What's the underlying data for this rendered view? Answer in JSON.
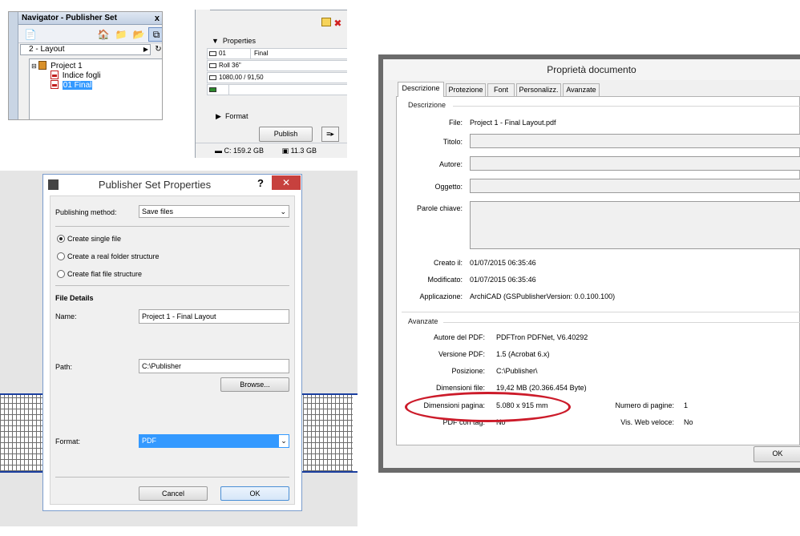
{
  "navigator": {
    "title": "Navigator - Publisher Set",
    "close": "x",
    "combo": "2 - Layout",
    "tree": {
      "root": "Project 1",
      "items": [
        "Indice fogli",
        "01 Final"
      ]
    }
  },
  "properties": {
    "section_properties": "Properties",
    "rows": [
      {
        "key": "01",
        "value": "Final"
      },
      {
        "key": "Roll 36\"",
        "value": ""
      },
      {
        "key": "1080,00 / 91,50",
        "value": ""
      },
      {
        "key": "",
        "value": ""
      }
    ],
    "section_format": "Format",
    "publish": "Publish",
    "disk_c": "C: 159.2 GB",
    "disk_other": "11.3 GB"
  },
  "publisher_set": {
    "title": "Publisher Set Properties",
    "help": "?",
    "publishing_method_label": "Publishing method:",
    "publishing_method_value": "Save files",
    "options": [
      "Create single file",
      "Create a real folder structure",
      "Create flat file structure"
    ],
    "selected_option": 0,
    "file_details": "File Details",
    "name_label": "Name:",
    "name_value": "Project 1 - Final  Layout",
    "path_label": "Path:",
    "path_value": "C:\\Publisher",
    "browse": "Browse...",
    "format_label": "Format:",
    "format_value": "PDF",
    "cancel": "Cancel",
    "ok": "OK"
  },
  "doc_props": {
    "title": "Proprietà documento",
    "tabs": [
      "Descrizione",
      "Protezione",
      "Font",
      "Personalizz.",
      "Avanzate"
    ],
    "active_tab": "Descrizione",
    "group_description": "Descrizione",
    "file_label": "File:",
    "file_value": "Project 1 - Final  Layout.pdf",
    "titolo_label": "Titolo:",
    "autore_label": "Autore:",
    "oggetto_label": "Oggetto:",
    "parole_label": "Parole chiave:",
    "creato_label": "Creato il:",
    "creato_value": "01/07/2015 06:35:46",
    "modificato_label": "Modificato:",
    "modificato_value": "01/07/2015 06:35:46",
    "applicazione_label": "Applicazione:",
    "applicazione_value": "ArchiCAD (GSPublisherVersion: 0.0.100.100)",
    "group_advanced": "Avanzate",
    "autore_pdf_label": "Autore del PDF:",
    "autore_pdf_value": "PDFTron PDFNet, V6.40292",
    "versione_label": "Versione PDF:",
    "versione_value": "1.5 (Acrobat 6.x)",
    "posizione_label": "Posizione:",
    "posizione_value": "C:\\Publisher\\",
    "dimensioni_file_label": "Dimensioni file:",
    "dimensioni_file_value": "19,42 MB (20.366.454 Byte)",
    "dimensioni_pagina_label": "Dimensioni pagina:",
    "dimensioni_pagina_value": "5.080 x 915 mm",
    "numero_pagine_label": "Numero di pagine:",
    "numero_pagine_value": "1",
    "pdf_tag_label": "PDF con tag:",
    "pdf_tag_value": "No",
    "vis_web_label": "Vis. Web veloce:",
    "vis_web_value": "No",
    "ok": "OK",
    "highlight_color": "#cc1b2a"
  }
}
